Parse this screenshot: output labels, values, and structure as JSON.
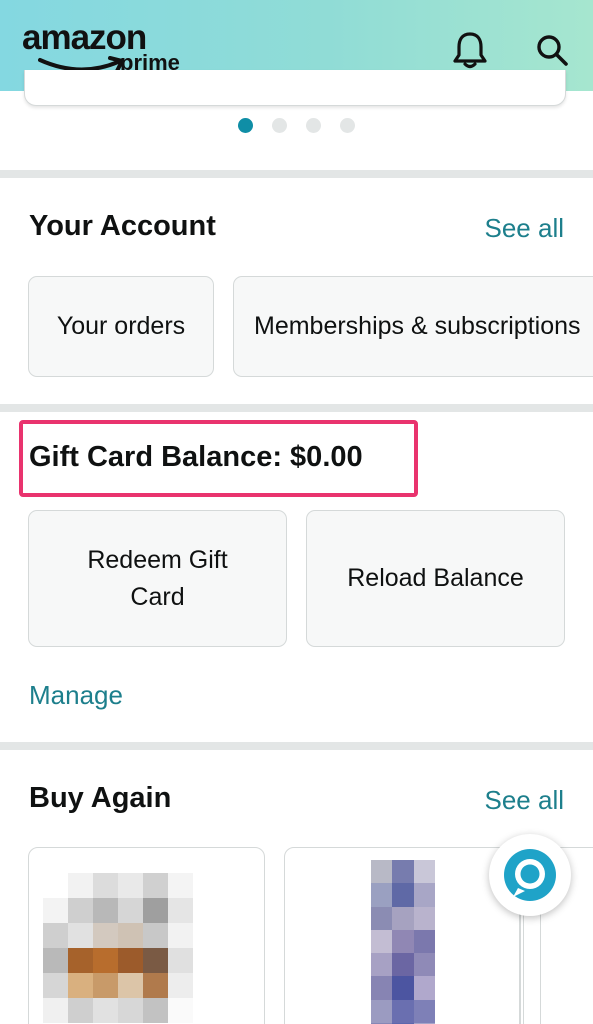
{
  "header": {
    "logo_main": "amazon",
    "logo_sub": "prime",
    "icons": [
      "bell-icon",
      "search-icon"
    ]
  },
  "carousel": {
    "page_count": 4,
    "active_index": 0
  },
  "account": {
    "title": "Your Account",
    "see_all": "See all",
    "tiles": [
      "Your orders",
      "Memberships & subscriptions"
    ]
  },
  "gift_card": {
    "balance_label": "Gift Card Balance: $0.00",
    "tiles": [
      "Redeem Gift\nCard",
      "Reload Balance"
    ],
    "manage": "Manage"
  },
  "buy_again": {
    "title": "Buy Again",
    "see_all": "See all"
  },
  "colors": {
    "header_gradient": [
      "#84d8e1",
      "#a6e6cf"
    ],
    "link": "#1d7f8c",
    "highlight": "#e9336e",
    "alexa": "#1fa3c8"
  }
}
